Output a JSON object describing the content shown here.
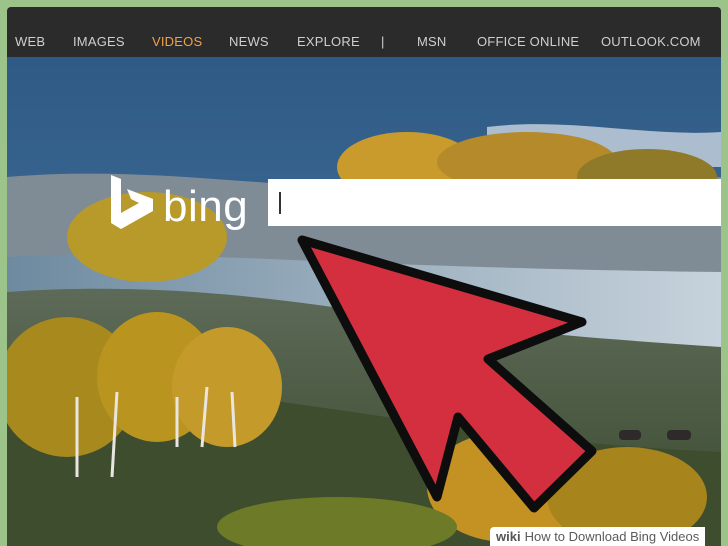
{
  "nav": {
    "items": [
      {
        "label": "WEB"
      },
      {
        "label": "IMAGES"
      },
      {
        "label": "VIDEOS",
        "active": true
      },
      {
        "label": "NEWS"
      },
      {
        "label": "EXPLORE"
      },
      {
        "label": "|"
      },
      {
        "label": "MSN"
      },
      {
        "label": "OFFICE ONLINE"
      },
      {
        "label": "OUTLOOK.COM"
      }
    ]
  },
  "logo": {
    "text": "bing"
  },
  "search": {
    "value": "",
    "placeholder": ""
  },
  "watermark": {
    "brand": "wiki",
    "title": "How to Download Bing Videos"
  },
  "colors": {
    "nav_bg": "#2b2b2b",
    "nav_text": "#cfcfcf",
    "nav_active": "#f0a24a",
    "arrow_fill": "#d32f3f",
    "frame": "#9cc48a"
  }
}
